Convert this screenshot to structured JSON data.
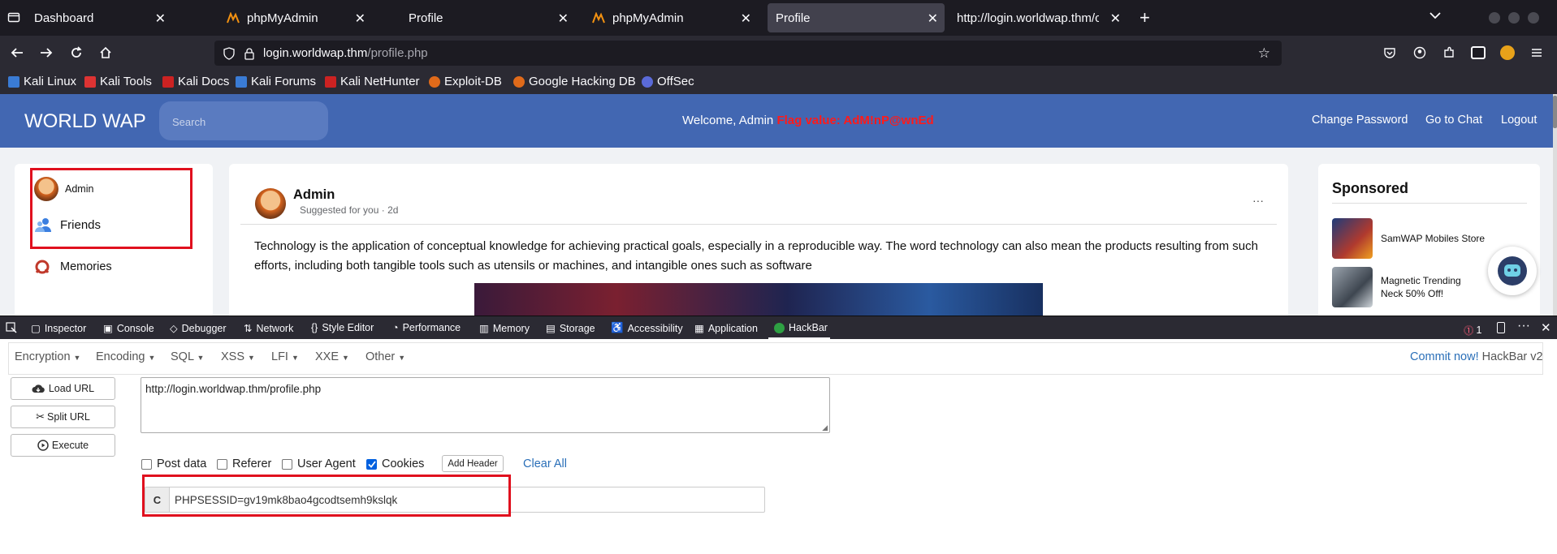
{
  "browser": {
    "tabs": [
      {
        "label": "Dashboard"
      },
      {
        "label": "phpMyAdmin"
      },
      {
        "label": "Profile"
      },
      {
        "label": "phpMyAdmin"
      },
      {
        "label": "Profile"
      },
      {
        "label": "http://login.worldwap.thm/cl"
      }
    ],
    "url_host": "login.worldwap.thm",
    "url_path": "/profile.php",
    "bookmarks": [
      "Kali Linux",
      "Kali Tools",
      "Kali Docs",
      "Kali Forums",
      "Kali NetHunter",
      "Exploit-DB",
      "Google Hacking DB",
      "OffSec"
    ]
  },
  "site": {
    "logo": "WORLD WAP",
    "search_placeholder": "Search",
    "welcome": "Welcome, Admin",
    "flag": "Flag value: AdM!nP@wnEd",
    "nav": [
      "Change Password",
      "Go to Chat",
      "Logout"
    ],
    "sidebar": {
      "user": "Admin",
      "friends": "Friends",
      "memories": "Memories"
    },
    "post": {
      "author": "Admin",
      "meta": "Suggested for you · 2d",
      "more": "···",
      "text": "Technology is the application of conceptual knowledge for achieving practical goals, especially in a reproducible way. The word technology can also mean the products resulting from such efforts, including both tangible tools such as utensils or machines, and intangible ones such as software"
    },
    "sponsored": {
      "title": "Sponsored",
      "items": [
        {
          "label": "SamWAP Mobiles Store"
        },
        {
          "label": "Magnetic Trending Neck 50% Off!"
        }
      ]
    }
  },
  "devtools": {
    "tabs": [
      "Inspector",
      "Console",
      "Debugger",
      "Network",
      "Style Editor",
      "Performance",
      "Memory",
      "Storage",
      "Accessibility",
      "Application",
      "HackBar"
    ],
    "error_count": "1"
  },
  "hackbar": {
    "menus": [
      "Encryption",
      "Encoding",
      "SQL",
      "XSS",
      "LFI",
      "XXE",
      "Other"
    ],
    "commit": "Commit now!",
    "version": "HackBar v2",
    "buttons": {
      "load": "Load URL",
      "split": "Split URL",
      "execute": "Execute"
    },
    "url_value": "http://login.worldwap.thm/profile.php",
    "options": [
      {
        "label": "Post data",
        "checked": false
      },
      {
        "label": "Referer",
        "checked": false
      },
      {
        "label": "User Agent",
        "checked": false
      },
      {
        "label": "Cookies",
        "checked": true
      }
    ],
    "add_header": "Add Header",
    "clear_all": "Clear All",
    "cookie_prefix": "C",
    "cookie_value": "PHPSESSID=gv19mk8bao4gcodtsemh9kslqk"
  },
  "colors": {
    "flag": "#ff1a1a",
    "site_header": "#4267b2",
    "highlight_box": "#e0101e",
    "link": "#2a6fb8"
  }
}
